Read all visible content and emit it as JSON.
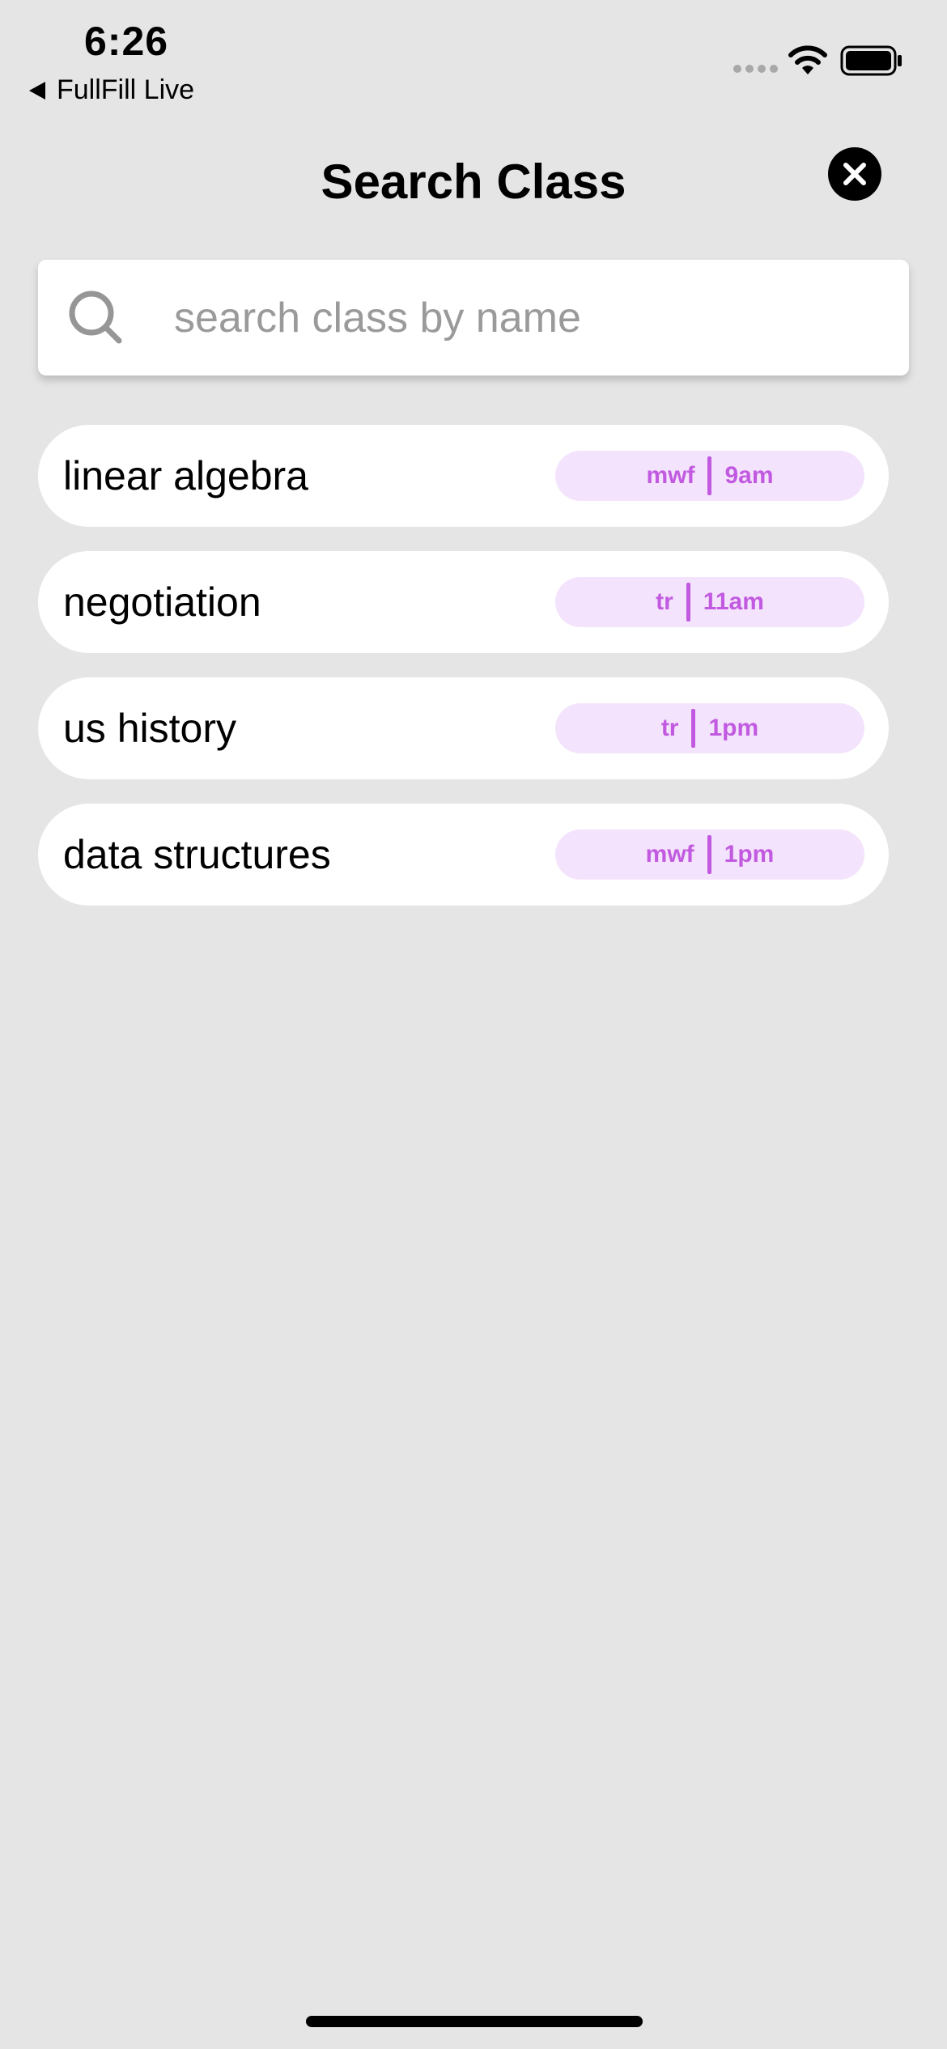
{
  "status_bar": {
    "time": "6:26",
    "back_label": "FullFill Live",
    "icons": [
      "signal-icon",
      "wifi-icon",
      "battery-icon"
    ]
  },
  "header": {
    "title": "Search Class",
    "close_icon": "close-icon"
  },
  "search": {
    "placeholder": "search class by name",
    "value": "",
    "icon": "search-icon"
  },
  "classes": [
    {
      "name": "linear algebra",
      "days": "mwf",
      "time": "9am"
    },
    {
      "name": "negotiation",
      "days": "tr",
      "time": "11am"
    },
    {
      "name": "us history",
      "days": "tr",
      "time": "1pm"
    },
    {
      "name": "data structures",
      "days": "mwf",
      "time": "1pm"
    }
  ],
  "colors": {
    "background": "#e5e5e5",
    "card": "#ffffff",
    "pill_background": "#f4e3fc",
    "accent": "#c15ae0"
  }
}
